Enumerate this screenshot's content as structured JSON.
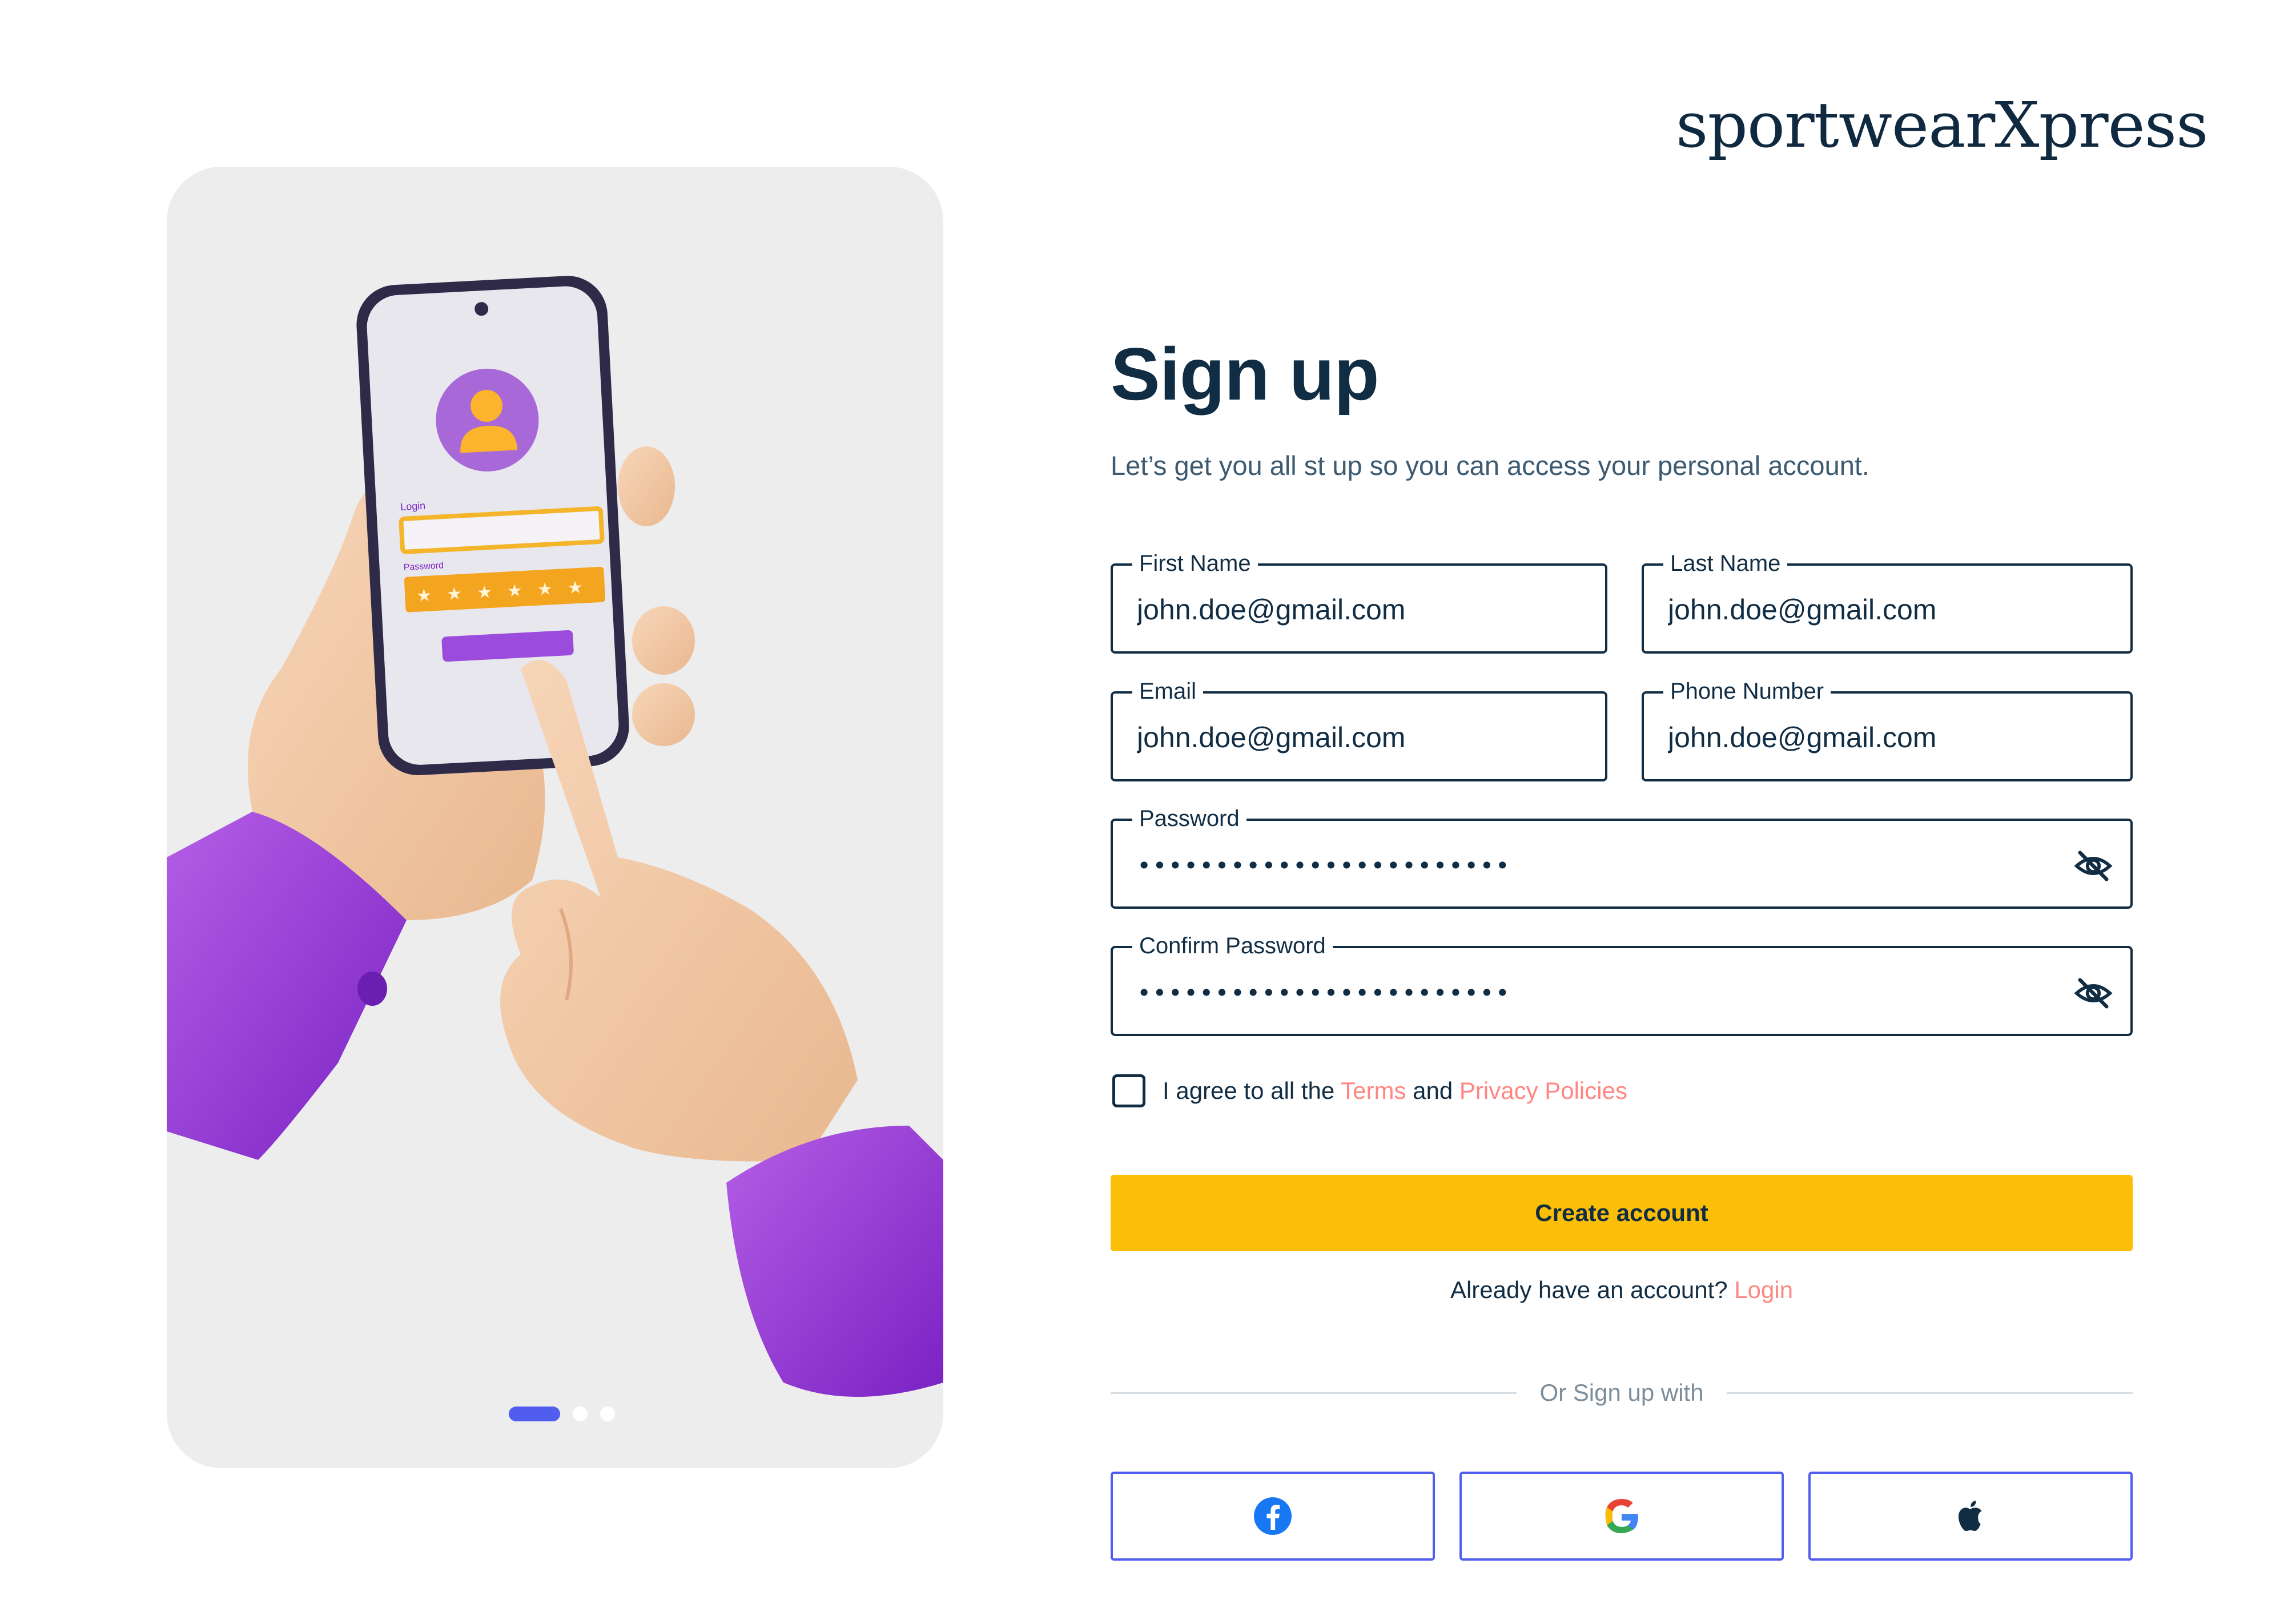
{
  "brand": {
    "name": "sportwearXpress"
  },
  "hero": {
    "phone_login_label": "Login",
    "phone_password_label": "Password",
    "carousel_pages": 3,
    "carousel_active": 1
  },
  "form": {
    "title": "Sign up",
    "subtitle": "Let’s get you all st up so you can access your personal account.",
    "first_name": {
      "label": "First Name",
      "value": "john.doe@gmail.com"
    },
    "last_name": {
      "label": "Last Name",
      "value": "john.doe@gmail.com"
    },
    "email": {
      "label": "Email",
      "value": "john.doe@gmail.com"
    },
    "phone": {
      "label": "Phone Number",
      "value": "john.doe@gmail.com"
    },
    "password": {
      "label": "Password",
      "value": "••••••••••••••••••••••••",
      "icon": "eye-off-icon"
    },
    "confirm_password": {
      "label": "Confirm Password",
      "value": "••••••••••••••••••••••••",
      "icon": "eye-off-icon"
    },
    "agree": {
      "prefix": "I agree to all the ",
      "terms": "Terms",
      "and": " and ",
      "privacy": "Privacy Policies",
      "checked": false
    },
    "create_button": "Create account",
    "login_prompt": "Already have an account? ",
    "login_link": "Login",
    "divider_text": "Or Sign up with",
    "social": [
      "facebook-icon",
      "google-icon",
      "apple-icon"
    ]
  },
  "colors": {
    "primary_dark": "#112d44",
    "accent_yellow": "#fcbf07",
    "link_salmon": "#ff8682",
    "social_border": "#515def",
    "hero_bg": "#ededee",
    "hand_skin": "#f3c9a6",
    "sleeve_purple": "#9a3fd6"
  }
}
